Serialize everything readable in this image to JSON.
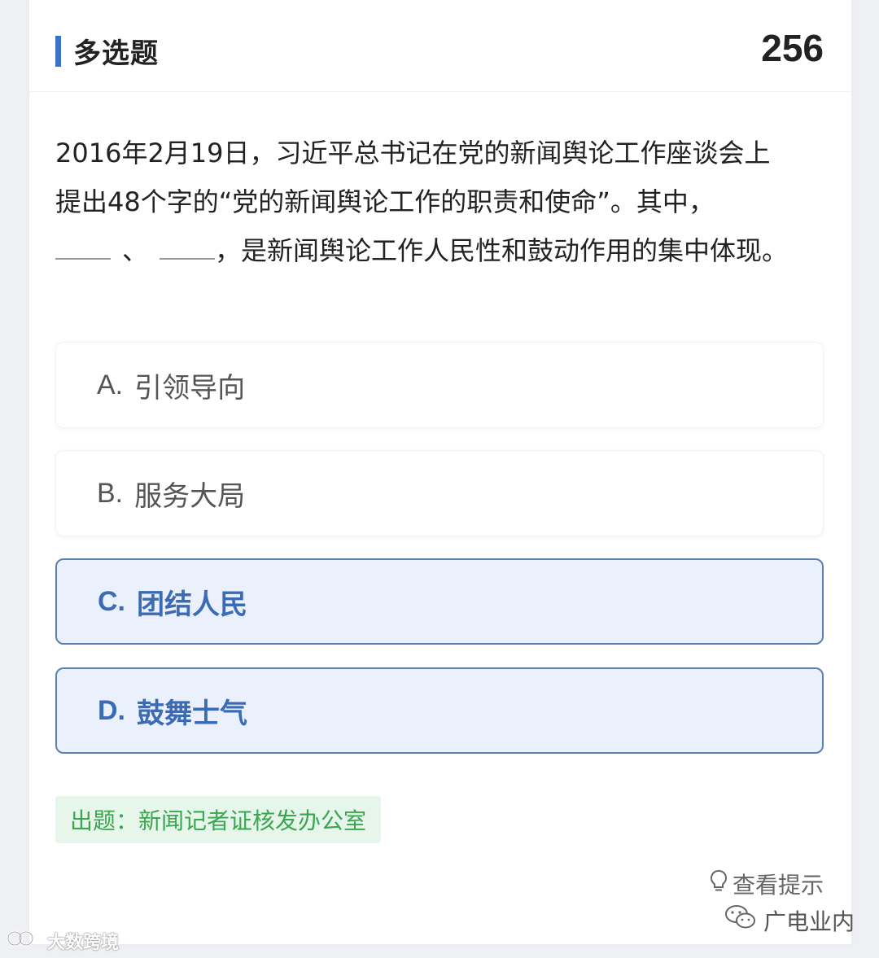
{
  "header": {
    "title": "多选题",
    "number": "256"
  },
  "question": {
    "text_line1": "2016年2月19日，习近平总书记在党的新闻舆论工作座谈会上",
    "text_line2": "提出48个字的“党的新闻舆论工作的职责和使命”。其中，",
    "separator": "、",
    "text_tail": "，是新闻舆论工作人民性和鼓动作用的集中体现。"
  },
  "options": [
    {
      "letter": "A.",
      "text": "引领导向",
      "selected": false
    },
    {
      "letter": "B.",
      "text": "服务大局",
      "selected": false
    },
    {
      "letter": "C.",
      "text": "团结人民",
      "selected": true
    },
    {
      "letter": "D.",
      "text": "鼓舞士气",
      "selected": true
    }
  ],
  "source": {
    "text": "出题：新闻记者证核发办公室"
  },
  "hint": {
    "icon": "lightbulb-icon",
    "label": "查看提示"
  },
  "watermarks": {
    "right": "广电业内",
    "right_icon": "wechat-icon",
    "left": "大数跨境",
    "left_icon": "logo-icon"
  },
  "colors": {
    "accent": "#3d72c9",
    "selected_bg": "#eaf1fd",
    "selected_border": "#5a7fb3",
    "source_bg": "#e7f6ea",
    "source_text": "#3aa650"
  }
}
